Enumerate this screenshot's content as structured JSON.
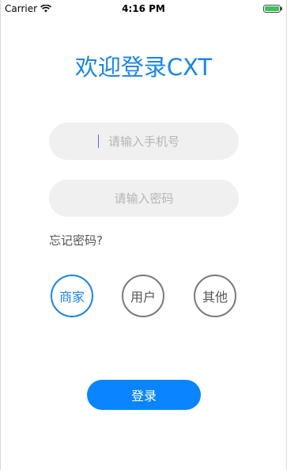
{
  "status_bar": {
    "carrier": "Carrier",
    "time": "4:16 PM",
    "wifi_icon": "wifi-icon",
    "battery_icon": "battery-icon",
    "battery_level": 1.0
  },
  "title": "欢迎登录CXT",
  "form": {
    "phone_placeholder": "请输入手机号",
    "phone_value": "",
    "password_placeholder": "请输入密码",
    "password_value": "",
    "forgot_label": "忘记密码?"
  },
  "roles": {
    "merchant": "商家",
    "user": "用户",
    "other": "其他",
    "selected": "商家"
  },
  "login_label": "登录",
  "colors": {
    "accent": "#1a85e6",
    "button": "#0a84ff",
    "input_bg": "#f0f0f0"
  }
}
